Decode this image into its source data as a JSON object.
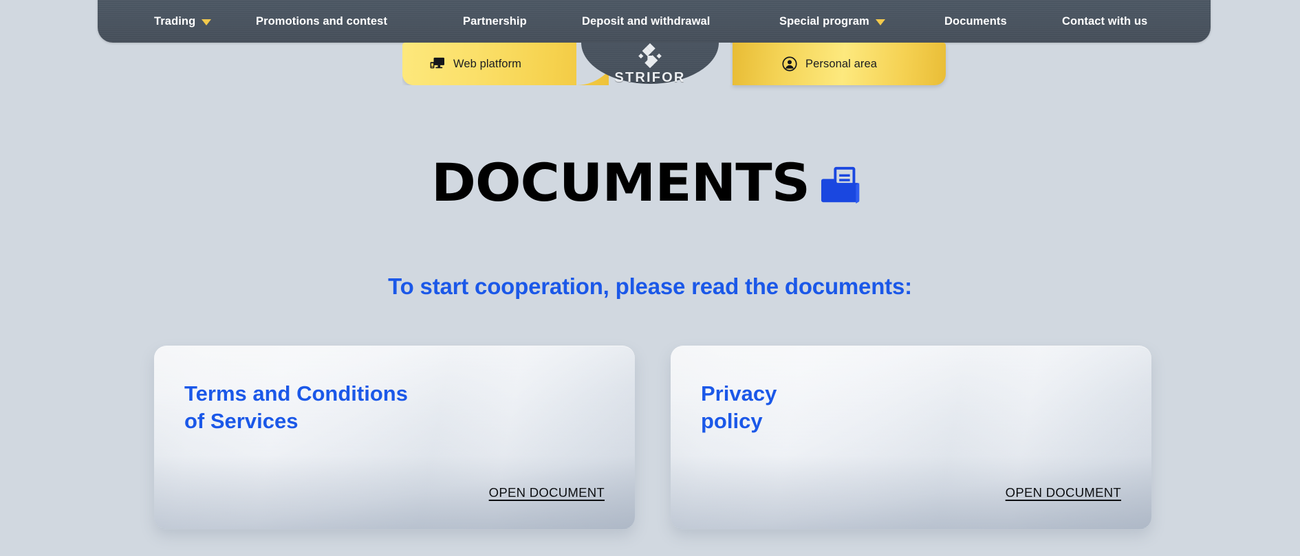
{
  "colors": {
    "page_background": "#d1d8e0",
    "nav_background": "#4b5662",
    "accent_yellow": "#f6d24e",
    "accent_blue": "#1b58e8",
    "title_black": "#000000"
  },
  "nav": {
    "items": [
      {
        "label": "Trading",
        "has_dropdown": true,
        "icon": "chevron-down-icon"
      },
      {
        "label": "Promotions and contest",
        "has_dropdown": false,
        "icon": ""
      },
      {
        "label": "Partnership",
        "has_dropdown": false,
        "icon": ""
      },
      {
        "label": "Deposit and withdrawal",
        "has_dropdown": false,
        "icon": ""
      },
      {
        "label": "Special program",
        "has_dropdown": true,
        "icon": "chevron-down-icon"
      },
      {
        "label": "Documents",
        "has_dropdown": false,
        "icon": ""
      },
      {
        "label": "Contact with us",
        "has_dropdown": false,
        "icon": ""
      }
    ]
  },
  "brand": {
    "name": "STRIFOR",
    "logo_icon": "strifor-diamond-s-logo"
  },
  "tabs": [
    {
      "label": "Web platform",
      "icon": "monitor-icon"
    },
    {
      "label": "Personal area",
      "icon": "user-circle-icon"
    }
  ],
  "hero": {
    "title": "DOCUMENTS",
    "title_icon": "folder-document-icon",
    "subtitle": "To start cooperation, please read the documents:"
  },
  "documents": [
    {
      "title": "Terms and Conditions\nof Services",
      "link_label": "OPEN DOCUMENT"
    },
    {
      "title": "Privacy\npolicy",
      "link_label": "OPEN DOCUMENT"
    }
  ]
}
